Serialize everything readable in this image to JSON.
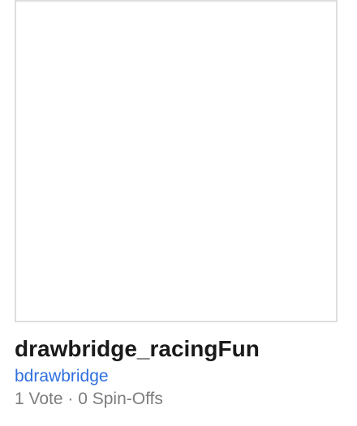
{
  "project": {
    "title": "drawbridge_racingFun",
    "author": "bdrawbridge",
    "votes": "1 Vote",
    "separator": " · ",
    "spinoffs": "0 Spin-Offs"
  },
  "colors": {
    "author_link": "#2f6fde",
    "meta_text": "#7d7d7d",
    "thumbnail_border": "#dedede"
  }
}
